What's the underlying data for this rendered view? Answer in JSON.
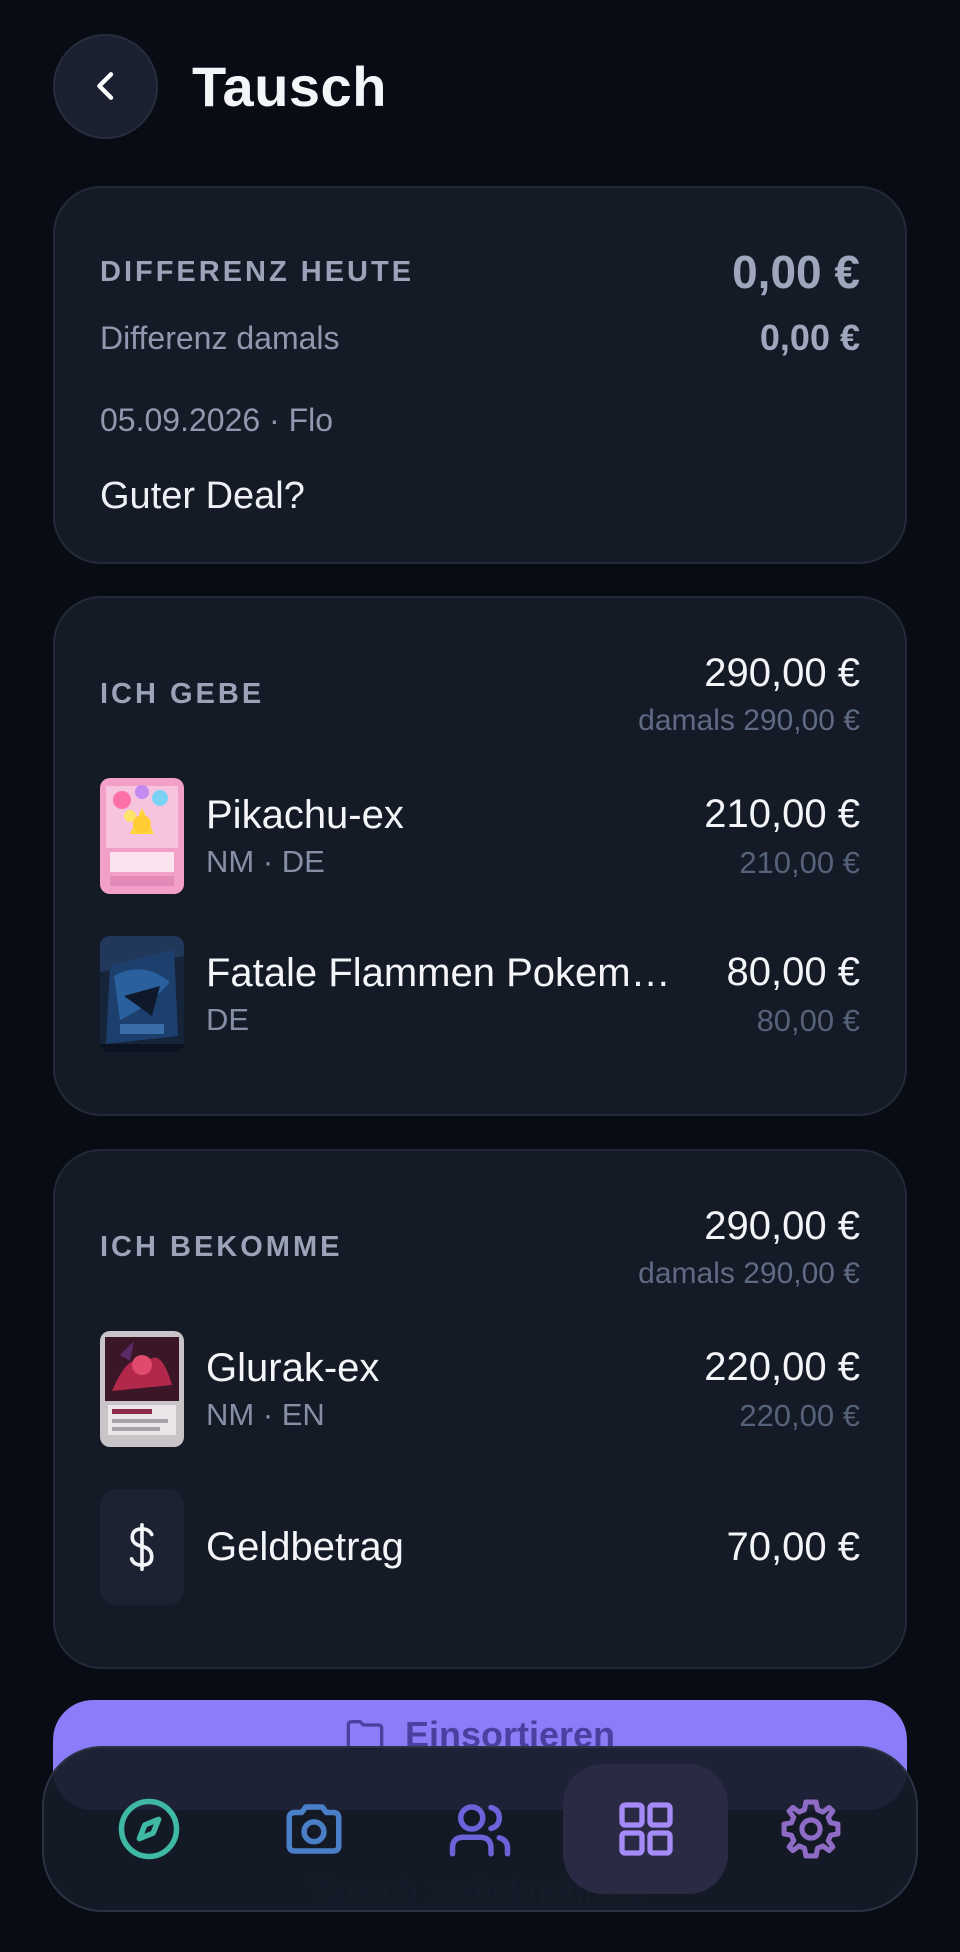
{
  "header": {
    "title": "Tausch",
    "back_icon": "chevron-left-icon"
  },
  "summary": {
    "diff_today_label": "DIFFERENZ HEUTE",
    "diff_today_value": "0,00 €",
    "diff_then_label": "Differenz damals",
    "diff_then_value": "0,00 €",
    "date_partner": "05.09.2026 · Flo",
    "note": "Guter Deal?"
  },
  "give": {
    "label": "ICH GEBE",
    "total": "290,00 €",
    "total_then": "damals 290,00 €",
    "items": [
      {
        "name": "Pikachu-ex",
        "sub": "NM · DE",
        "price": "210,00 €",
        "price_then": "210,00 €"
      },
      {
        "name": "Fatale Flammen Pokem…",
        "sub": "DE",
        "price": "80,00 €",
        "price_then": "80,00 €"
      }
    ]
  },
  "get": {
    "label": "ICH BEKOMME",
    "total": "290,00 €",
    "total_then": "damals 290,00 €",
    "items": [
      {
        "name": "Glurak-ex",
        "sub": "NM · EN",
        "price": "220,00 €",
        "price_then": "220,00 €"
      }
    ],
    "money": {
      "name": "Geldbetrag",
      "price": "70,00 €",
      "icon": "dollar-icon"
    }
  },
  "actions": {
    "primary_label": "Einsortieren",
    "secondary_label": "Tausch zurücknehmen"
  },
  "tabbar": {
    "tabs": [
      {
        "name": "discover",
        "icon": "compass-icon",
        "color": "#3fb9a4"
      },
      {
        "name": "scan",
        "icon": "camera-icon",
        "color": "#4a7fc8"
      },
      {
        "name": "friends",
        "icon": "users-icon",
        "color": "#6a63d9"
      },
      {
        "name": "collection",
        "icon": "grid-icon",
        "color": "#a58bf7",
        "active": true
      },
      {
        "name": "settings",
        "icon": "gear-icon",
        "color": "#8e6bc4"
      }
    ]
  },
  "colors": {
    "accent": "#8b7cf8",
    "background": "#090c14",
    "card": "#141a26"
  }
}
